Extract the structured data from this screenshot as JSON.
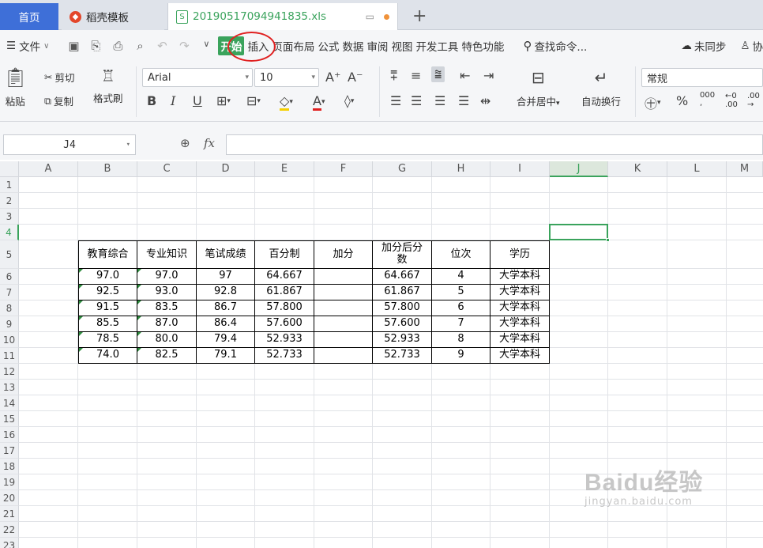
{
  "tabs": {
    "home": "首页",
    "template": "稻壳模板",
    "file": "20190517094941835.xls",
    "new_tab": "+"
  },
  "menu": {
    "file": "文件",
    "items": [
      "开始",
      "插入",
      "页面布局",
      "公式",
      "数据",
      "审阅",
      "视图",
      "开发工具",
      "特色功能"
    ],
    "search": "查找命令...",
    "sync": "未同步",
    "collab": "协"
  },
  "ribbon": {
    "paste": "粘贴",
    "cut": "剪切",
    "copy": "复制",
    "format_painter": "格式刷",
    "font_name": "Arial",
    "font_size": "10",
    "bold": "B",
    "italic": "I",
    "underline": "U",
    "merge_center": "合并居中",
    "wrap_text": "自动换行",
    "number_format": "常规",
    "percent": "%"
  },
  "formula_bar": {
    "cell_ref": "J4",
    "fx": "fx",
    "formula": ""
  },
  "sheet": {
    "columns": [
      "A",
      "B",
      "C",
      "D",
      "E",
      "F",
      "G",
      "H",
      "I",
      "J",
      "K",
      "L",
      "M"
    ],
    "rows": [
      "1",
      "2",
      "3",
      "4",
      "5",
      "6",
      "7",
      "8",
      "9",
      "10",
      "11",
      "12",
      "13",
      "14",
      "15",
      "16",
      "17",
      "18",
      "19",
      "20",
      "21",
      "22",
      "23"
    ],
    "active_cell": "J4",
    "table": {
      "headers": [
        "教育综合",
        "专业知识",
        "笔试成绩",
        "百分制",
        "加分",
        "加分后分数",
        "位次",
        "学历"
      ],
      "rows": [
        [
          "97.0",
          "97.0",
          "97",
          "64.667",
          "",
          "64.667",
          "4",
          "大学本科"
        ],
        [
          "92.5",
          "93.0",
          "92.8",
          "61.867",
          "",
          "61.867",
          "5",
          "大学本科"
        ],
        [
          "91.5",
          "83.5",
          "86.7",
          "57.800",
          "",
          "57.800",
          "6",
          "大学本科"
        ],
        [
          "85.5",
          "87.0",
          "86.4",
          "57.600",
          "",
          "57.600",
          "7",
          "大学本科"
        ],
        [
          "78.5",
          "80.0",
          "79.4",
          "52.933",
          "",
          "52.933",
          "8",
          "大学本科"
        ],
        [
          "74.0",
          "82.5",
          "79.1",
          "52.733",
          "",
          "52.733",
          "9",
          "大学本科"
        ]
      ]
    }
  },
  "watermark": {
    "main": "Baidu经验",
    "sub": "jingyan.baidu.com"
  },
  "colors": {
    "accent_green": "#3aa35c",
    "home_tab_blue": "#3e6fd8",
    "highlight_circle": "#e02020"
  }
}
